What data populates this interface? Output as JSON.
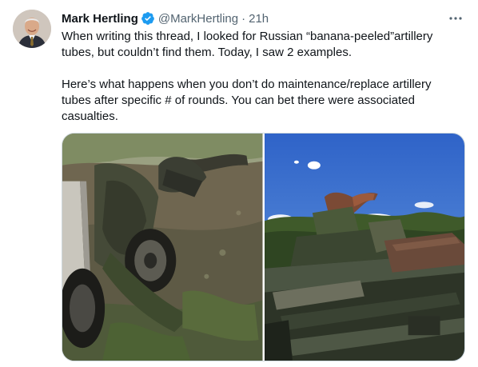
{
  "tweet": {
    "author_name": "Mark Hertling",
    "handle": "@MarkHertling",
    "separator": "·",
    "time": "21h",
    "paragraphs": [
      "When writing this thread, I looked for Russian “banana-peeled”artillery tubes, but couldn’t find them. Today, I saw 2 examples.",
      "Here’s what happens when you don’t do maintenance/replace artillery tubes after specific # of rounds. You can bet there were associated casualties."
    ]
  },
  "icons": {
    "verified": "verified-badge-icon",
    "more": "more-options-icon"
  },
  "colors": {
    "verified_blue": "#1d9bf0",
    "text_primary": "#0f1419",
    "text_secondary": "#536471",
    "border": "#cfd9de"
  }
}
